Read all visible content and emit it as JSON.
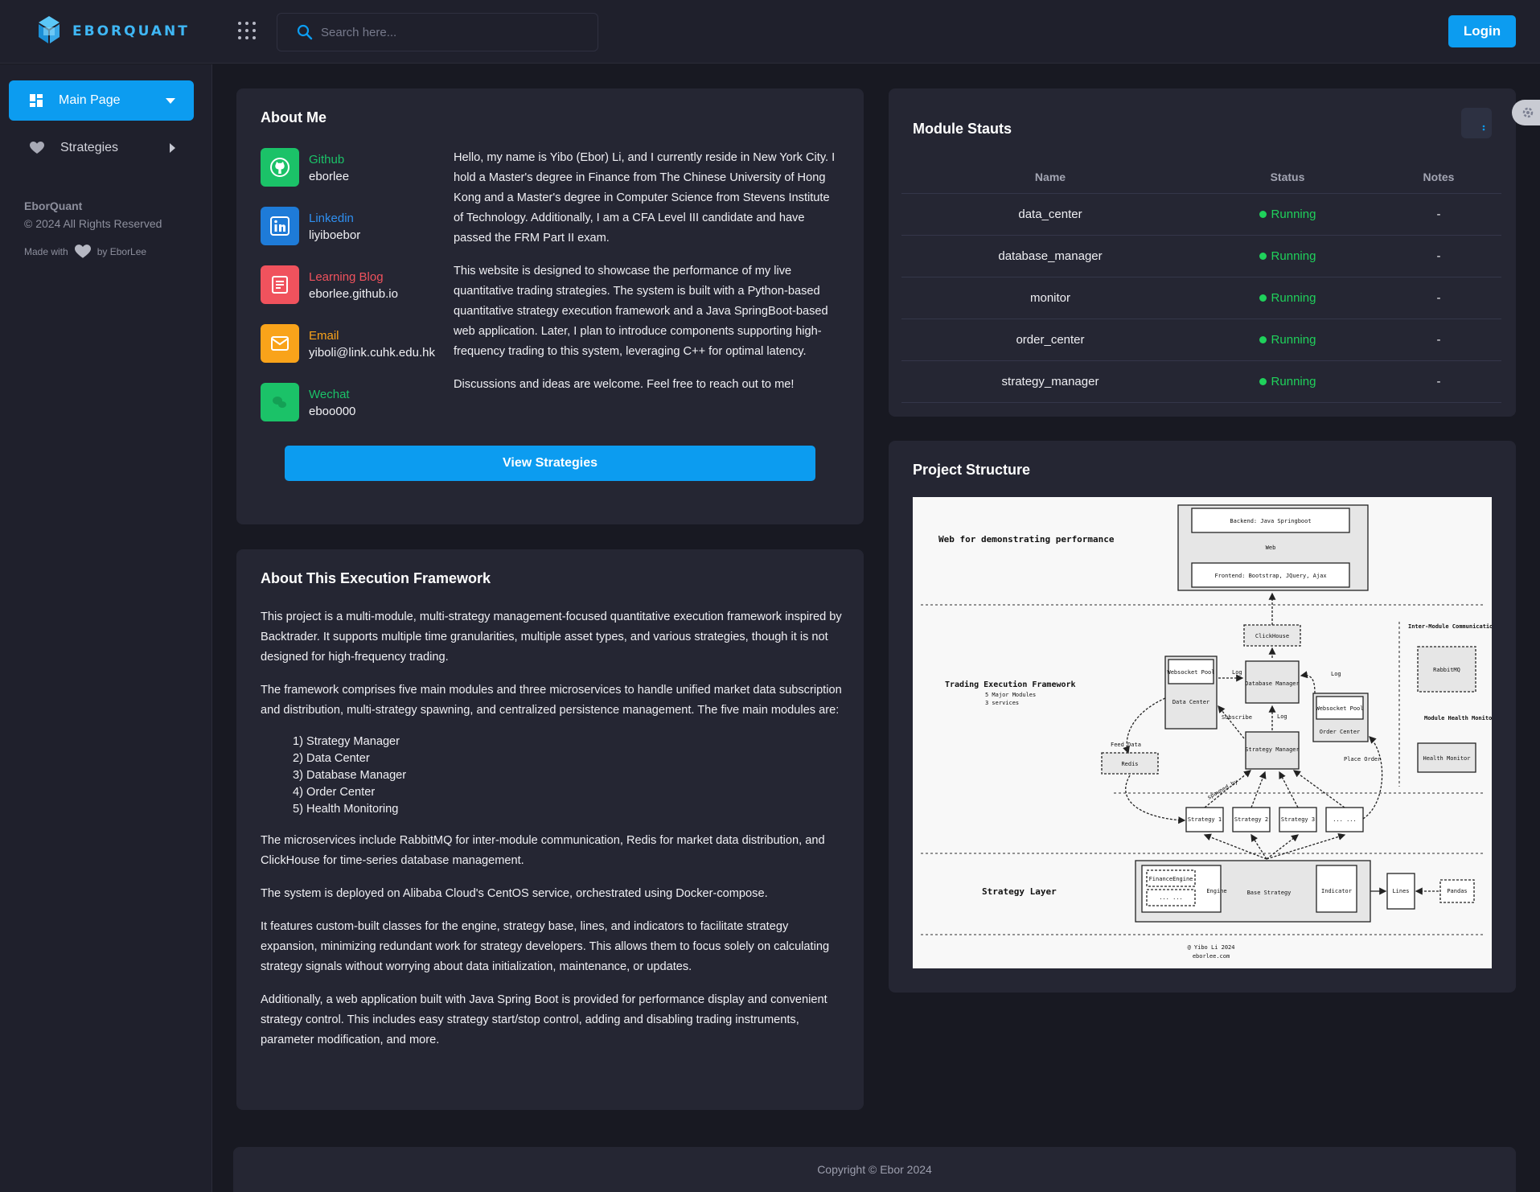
{
  "brand": {
    "name": "EBORQUANT",
    "accent": "#0c9cf0"
  },
  "search": {
    "placeholder": "Search here..."
  },
  "header": {
    "login_label": "Login"
  },
  "sidebar": {
    "items": [
      {
        "label": "Main Page",
        "icon": "dashboard-icon",
        "active": true
      },
      {
        "label": "Strategies",
        "icon": "heart-icon",
        "active": false
      }
    ],
    "footer": {
      "brand": "EborQuant",
      "copyright": "© 2024 All Rights Reserved",
      "made_with": "Made with",
      "by": "by EborLee"
    }
  },
  "about_me": {
    "title": "About Me",
    "contacts": [
      {
        "label": "Github",
        "value": "eborlee",
        "icon": "github-icon",
        "color": "#1bc268"
      },
      {
        "label": "Linkedin",
        "value": "liyiboebor",
        "icon": "linkedin-icon",
        "color": "#1e7bd8"
      },
      {
        "label": "Learning Blog",
        "value": "eborlee.github.io",
        "icon": "blog-icon",
        "color": "#f0525d"
      },
      {
        "label": "Email",
        "value": "yiboli@link.cuhk.edu.hk",
        "icon": "mail-icon",
        "color": "#f9a31a"
      },
      {
        "label": "Wechat",
        "value": "eboo000",
        "icon": "wechat-icon",
        "color": "#1bc268"
      }
    ],
    "paragraphs": [
      "Hello, my name is Yibo (Ebor) Li, and I currently reside in New York City. I hold a Master's degree in Finance from The Chinese University of Hong Kong and a Master's degree in Computer Science from Stevens Institute of Technology. Additionally, I am a CFA Level III candidate and have passed the FRM Part II exam.",
      "This website is designed to showcase the performance of my live quantitative trading strategies. The system is built with a Python-based quantitative strategy execution framework and a Java SpringBoot-based web application. Later, I plan to introduce components supporting high-frequency trading to this system, leveraging C++ for optimal latency.",
      "Discussions and ideas are welcome. Feel free to reach out to me!"
    ],
    "button": "View Strategies"
  },
  "framework": {
    "title": "About This Execution Framework",
    "p1": "This project is a multi-module, multi-strategy management-focused quantitative execution framework inspired by Backtrader. It supports multiple time granularities, multiple asset types, and various strategies, though it is not designed for high-frequency trading.",
    "p2": "The framework comprises five main modules and three microservices to handle unified market data subscription and distribution, multi-strategy spawning, and centralized persistence management. The five main modules are:",
    "modules": [
      "1) Strategy Manager",
      "2) Data Center",
      "3) Database Manager",
      "4) Order Center",
      "5) Health Monitoring"
    ],
    "p3": "The microservices include RabbitMQ for inter-module communication, Redis for market data distribution, and ClickHouse for time-series database management.",
    "p4": "The system is deployed on Alibaba Cloud's CentOS service, orchestrated using Docker-compose.",
    "p5": "It features custom-built classes for the engine, strategy base, lines, and indicators to facilitate strategy expansion, minimizing redundant work for strategy developers. This allows them to focus solely on calculating strategy signals without worrying about data initialization, maintenance, or updates.",
    "p6": "Additionally, a web application built with Java Spring Boot is provided for performance display and convenient strategy control. This includes easy strategy start/stop control, adding and disabling trading instruments, parameter modification, and more."
  },
  "module_status": {
    "title": "Module Stauts",
    "columns": [
      "Name",
      "Status",
      "Notes"
    ],
    "rows": [
      {
        "name": "data_center",
        "status": "Running",
        "notes": "-"
      },
      {
        "name": "database_manager",
        "status": "Running",
        "notes": "-"
      },
      {
        "name": "monitor",
        "status": "Running",
        "notes": "-"
      },
      {
        "name": "order_center",
        "status": "Running",
        "notes": "-"
      },
      {
        "name": "strategy_manager",
        "status": "Running",
        "notes": "-"
      }
    ]
  },
  "project_structure": {
    "title": "Project Structure",
    "diagram": {
      "web_section": "Web for demonstrating performance",
      "backend": "Backend: Java Springboot",
      "web": "Web",
      "frontend": "Frontend: Bootstrap, JQuery, Ajax",
      "clickhouse": "ClickHouse",
      "inter_module": "Inter-Module Communication",
      "rabbitmq": "RabbitMQ",
      "websocket_pool": "Websocket Pool",
      "data_center": "Data Center",
      "database_manager": "Database Manager",
      "order_center": "Order Center",
      "log": "Log",
      "subscribe": "Subscribe",
      "feed_data": "Feed Data",
      "redis": "Redis",
      "strategy_manager": "Strategy Manager",
      "spawned_by": "spawned by",
      "place_order": "Place Order",
      "module_health": "Module Health Monitoring",
      "health_monitor": "Health Monitor",
      "tef_title": "Trading Execution Framework",
      "tef_sub1": "5 Major Modules",
      "tef_sub2": "3 services",
      "strategies": [
        "Strategy 1",
        "Strategy 2",
        "Strategy 3",
        "... ..."
      ],
      "strategy_layer": "Strategy Layer",
      "finance_engine": "FinanceEngine",
      "dots": "... ...",
      "engine": "Engine",
      "base_strategy": "Base Strategy",
      "indicator": "Indicator",
      "lines": "Lines",
      "pandas": "Pandas",
      "credit1": "@ Yibo Li 2024",
      "credit2": "eborlee.com"
    }
  },
  "footer": {
    "text": "Copyright © Ebor 2024"
  }
}
